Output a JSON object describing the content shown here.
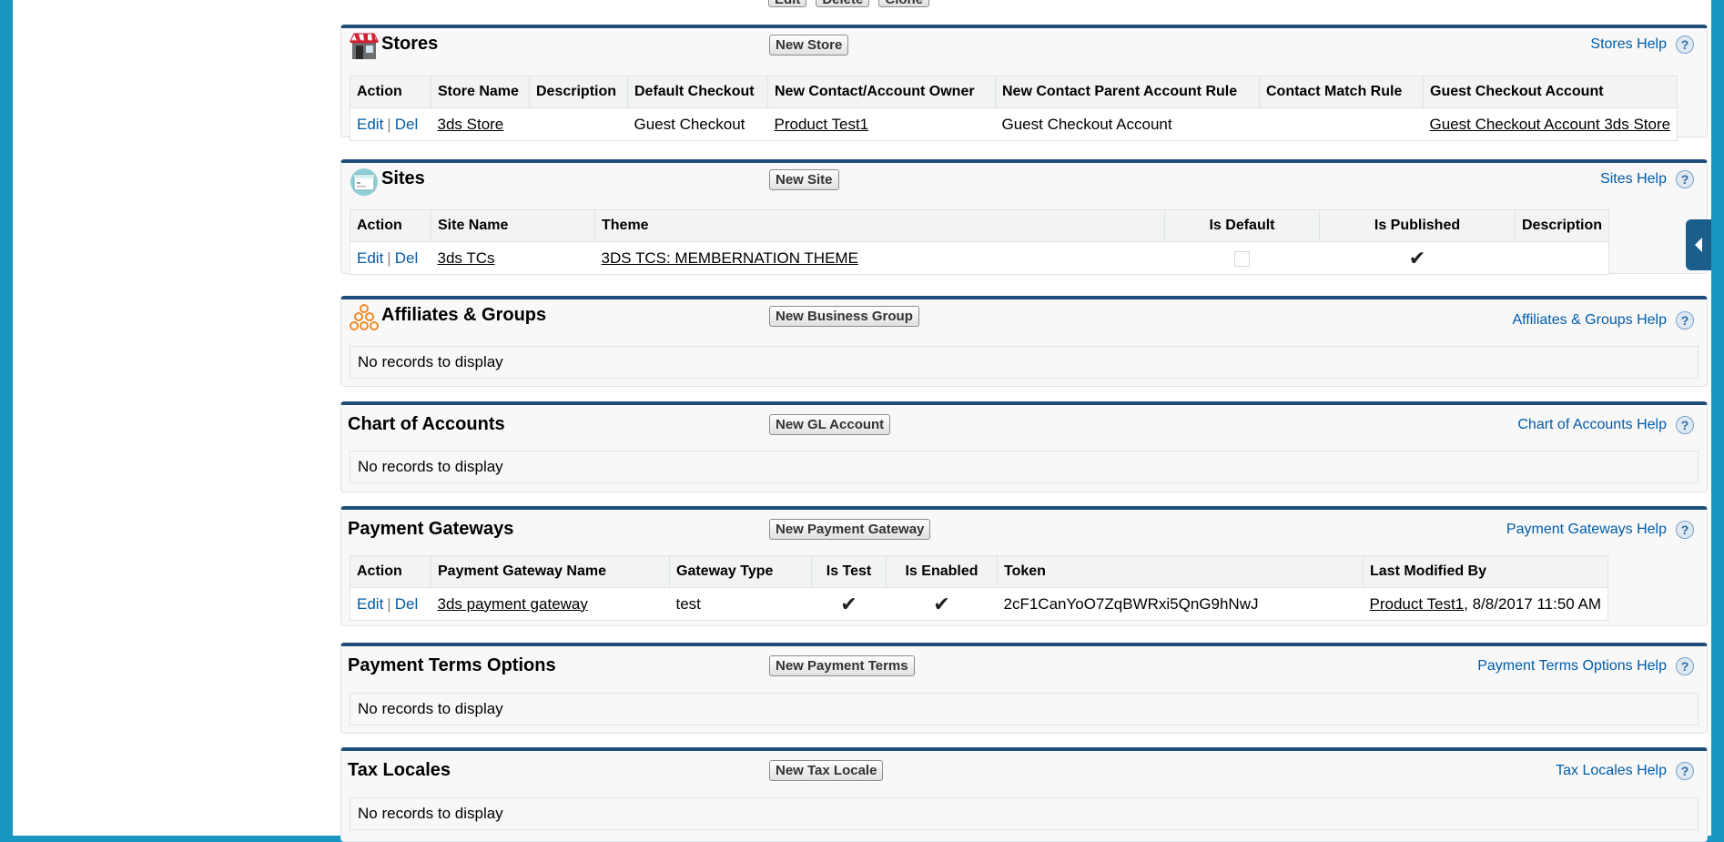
{
  "top_buttons": {
    "edit": "Edit",
    "delete": "Delete",
    "clone": "Clone"
  },
  "stores": {
    "title": "Stores",
    "new_button": "New Store",
    "help": "Stores Help",
    "columns": [
      "Action",
      "Store Name",
      "Description",
      "Default Checkout",
      "New Contact/Account Owner",
      "New Contact Parent Account Rule",
      "Contact Match Rule",
      "Guest Checkout Account"
    ],
    "row": {
      "edit": "Edit",
      "del": "Del",
      "store_name": "3ds Store",
      "description": "",
      "default_checkout": "Guest Checkout",
      "owner": "Product Test1",
      "parent_rule": "Guest Checkout Account",
      "match_rule": "",
      "guest_account": "Guest Checkout Account 3ds Store"
    }
  },
  "sites": {
    "title": "Sites",
    "new_button": "New Site",
    "help": "Sites Help",
    "columns": [
      "Action",
      "Site Name",
      "Theme",
      "Is Default",
      "Is Published",
      "Description"
    ],
    "row": {
      "edit": "Edit",
      "del": "Del",
      "site_name": "3ds TCs",
      "theme": "3DS TCS: MEMBERNATION THEME",
      "is_default": false,
      "is_published": true,
      "published_mark": "✔",
      "description": ""
    }
  },
  "affiliates": {
    "title": "Affiliates & Groups",
    "new_button": "New Business Group",
    "help": "Affiliates & Groups Help",
    "empty": "No records to display"
  },
  "chart_of_accounts": {
    "title": "Chart of Accounts",
    "new_button": "New GL Account",
    "help": "Chart of Accounts Help",
    "empty": "No records to display"
  },
  "payment_gateways": {
    "title": "Payment Gateways",
    "new_button": "New Payment Gateway",
    "help": "Payment Gateways Help",
    "columns": [
      "Action",
      "Payment Gateway Name",
      "Gateway Type",
      "Is Test",
      "Is Enabled",
      "Token",
      "Last Modified By"
    ],
    "row": {
      "edit": "Edit",
      "del": "Del",
      "name": "3ds payment gateway",
      "type": "test",
      "is_test": true,
      "is_enabled": true,
      "check_mark": "✔",
      "token": "2cF1CanYoO7ZqBWRxi5QnG9hNwJ",
      "modified_by": "Product Test1",
      "modified_at": ", 8/8/2017 11:50 AM"
    }
  },
  "payment_terms": {
    "title": "Payment Terms Options",
    "new_button": "New Payment Terms",
    "help": "Payment Terms Options Help",
    "empty": "No records to display"
  },
  "tax_locales": {
    "title": "Tax Locales",
    "new_button": "New Tax Locale",
    "help": "Tax Locales Help",
    "empty": "No records to display"
  },
  "help_glyph": "?",
  "colors": {
    "accent": "#1f4d7a",
    "link": "#015ba7",
    "frame": "#1797c0"
  }
}
